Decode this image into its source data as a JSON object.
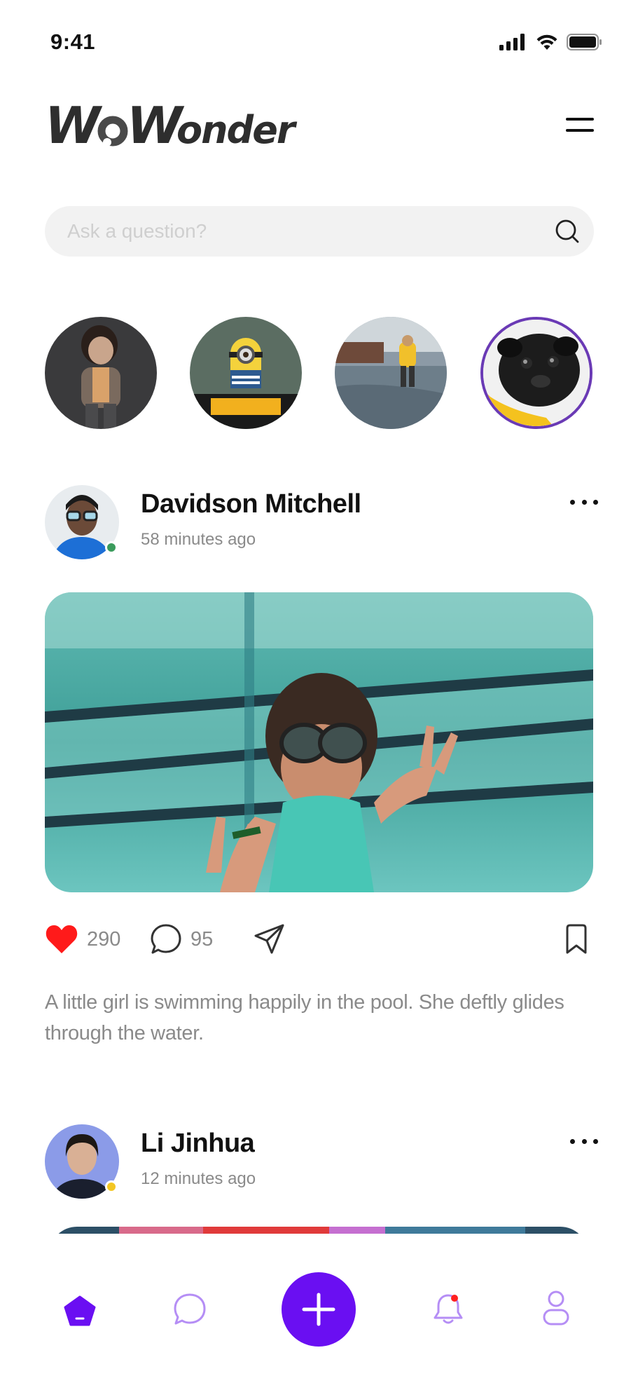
{
  "status_bar": {
    "time": "9:41"
  },
  "app": {
    "logo_text": "WoWonder"
  },
  "search": {
    "placeholder": "Ask a question?"
  },
  "stories": [
    {
      "name": "story-1"
    },
    {
      "name": "story-2"
    },
    {
      "name": "story-3"
    },
    {
      "name": "story-4",
      "active": true
    }
  ],
  "posts": [
    {
      "author": "Davidson Mitchell",
      "time": "58 minutes ago",
      "status_color": "#3a9b5c",
      "likes": "290",
      "comments": "95",
      "caption": "A little girl is swimming happily in the pool. She deftly glides through the water."
    },
    {
      "author": "Li Jinhua",
      "time": "12 minutes ago",
      "status_color": "#f3c623"
    }
  ],
  "nav": {
    "items": [
      "home-icon",
      "chat-icon",
      "add-icon",
      "notifications-icon",
      "profile-icon"
    ],
    "accent_color": "#6a0ff2",
    "notification_dot_color": "#ff2020"
  },
  "colors": {
    "like": "#ff1a1a",
    "story_ring": "#6a3ab5"
  }
}
